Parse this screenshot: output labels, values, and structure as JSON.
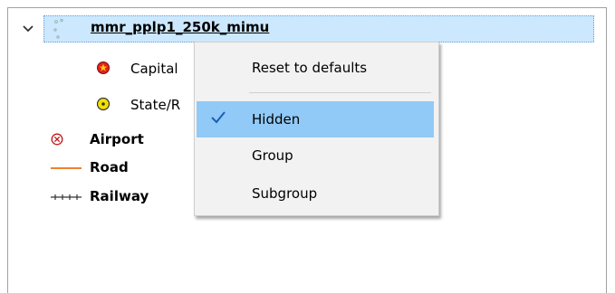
{
  "tree": {
    "group_label": "mmr_pplp1_250k_mimu",
    "children": [
      {
        "label": "Capital",
        "icon": "capital-star-icon"
      },
      {
        "label": "State/R",
        "icon": "state-dot-icon"
      }
    ],
    "items": [
      {
        "label": "Airport",
        "icon": "airport-icon"
      },
      {
        "label": "Road",
        "icon": "road-line-icon"
      },
      {
        "label": "Railway",
        "icon": "railway-icon"
      }
    ]
  },
  "context_menu": {
    "items": [
      {
        "label": "Reset to defaults",
        "checked": false
      },
      {
        "label": "Hidden",
        "checked": true
      },
      {
        "label": "Group",
        "checked": false
      },
      {
        "label": "Subgroup",
        "checked": false
      }
    ]
  },
  "colors": {
    "selection": "#cce8ff",
    "menu_highlight": "#91c9f7",
    "road": "#f08030",
    "capital_fill": "#e52020",
    "state_fill": "#f4e000",
    "airport": "#c01818"
  }
}
